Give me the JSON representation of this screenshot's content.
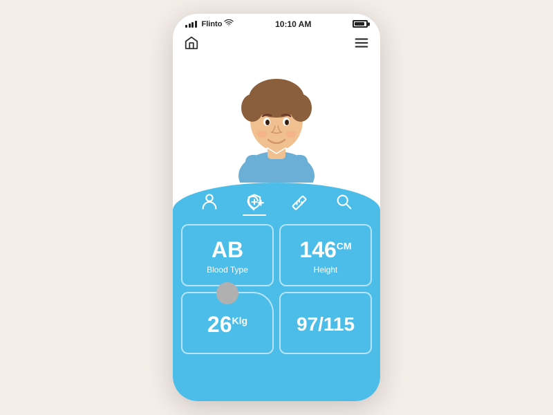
{
  "status_bar": {
    "carrier": "Flinto",
    "time": "10:10 AM",
    "wifi": true
  },
  "nav": {
    "home_label": "Home",
    "menu_label": "Menu"
  },
  "icons": [
    {
      "name": "person-icon",
      "label": "Person",
      "active": false
    },
    {
      "name": "shield-plus-icon",
      "label": "Health",
      "active": true
    },
    {
      "name": "ruler-icon",
      "label": "Measure",
      "active": false
    },
    {
      "name": "search-icon",
      "label": "Search",
      "active": false
    }
  ],
  "stats": [
    {
      "id": "blood-type",
      "value": "AB",
      "unit": "",
      "label": "Blood Type"
    },
    {
      "id": "height",
      "value": "146",
      "unit": "CM",
      "label": "Height"
    },
    {
      "id": "weight",
      "value": "26",
      "unit": "Klg",
      "label": ""
    },
    {
      "id": "bp",
      "value": "97/115",
      "unit": "",
      "label": ""
    }
  ],
  "colors": {
    "blue": "#4bbde8",
    "white": "#ffffff",
    "background": "#f5ede8"
  }
}
